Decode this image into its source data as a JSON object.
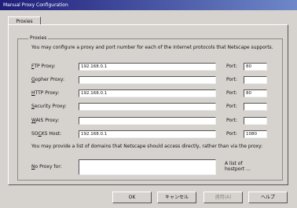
{
  "window": {
    "title": "Manual Proxy Configuration"
  },
  "tabs": [
    {
      "label": "Proxies"
    }
  ],
  "group": {
    "title": "Proxies",
    "description": "You may configure a proxy and port number for each of the internet protocols that Netscape supports.",
    "exceptions_description": "You may provide a list of domains that Netscape should access directly, rather than via the proxy:"
  },
  "rows": [
    {
      "label": "FTP Proxy:",
      "accel": "F",
      "value": "192.168.0.1",
      "port_label": "Port:",
      "port": "80"
    },
    {
      "label": "Gopher Proxy:",
      "accel": "G",
      "value": "",
      "port_label": "Port:",
      "port": ""
    },
    {
      "label": "HTTP Proxy:",
      "accel": "H",
      "value": "192.168.0.1",
      "port_label": "Port:",
      "port": "80"
    },
    {
      "label": "Security Proxy:",
      "accel": "S",
      "value": "",
      "port_label": "Port:",
      "port": ""
    },
    {
      "label": "WAIS Proxy:",
      "accel": "W",
      "value": "",
      "port_label": "Port:",
      "port": ""
    },
    {
      "label": "SOCKS Host:",
      "accel": "C",
      "value": "192.168.0.1",
      "port_label": "Port:",
      "port": "1080"
    }
  ],
  "no_proxy": {
    "label": "No Proxy for:",
    "accel": "N",
    "value": "",
    "hint": "A list of hostport ..."
  },
  "buttons": {
    "ok": "OK",
    "cancel": "キャンセル",
    "apply": "適用(A)",
    "help": "ヘルプ"
  }
}
